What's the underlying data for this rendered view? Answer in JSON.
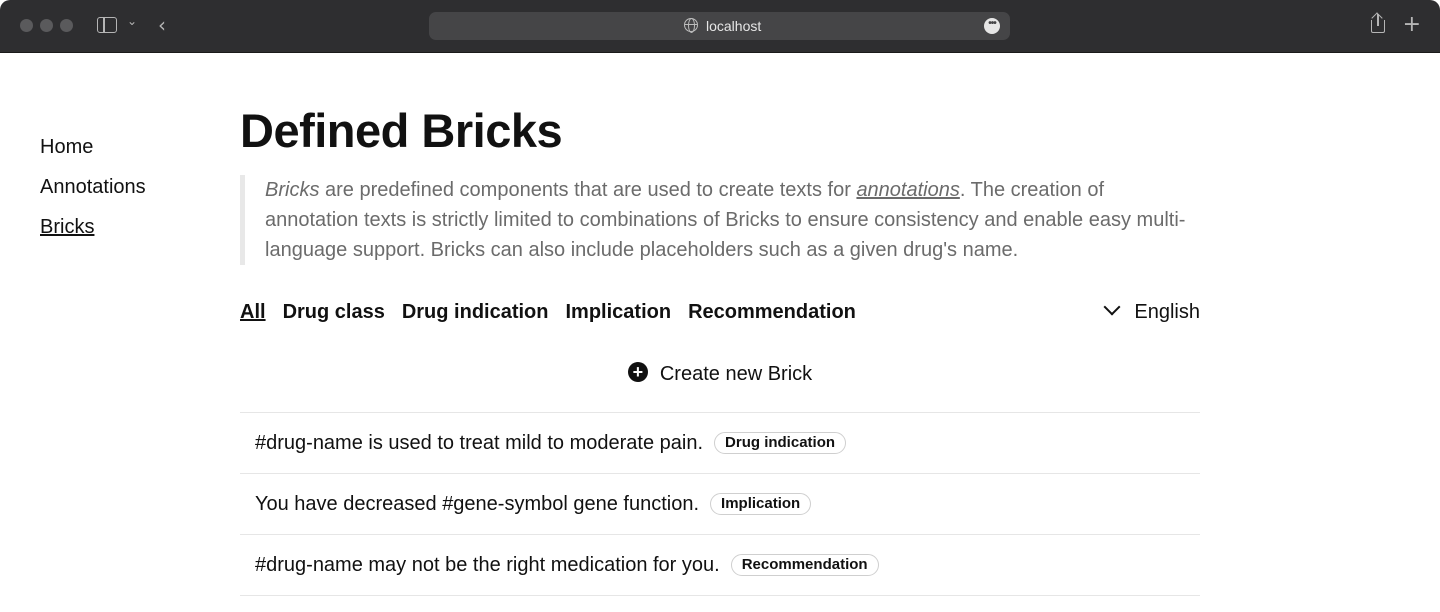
{
  "browser": {
    "url": "localhost"
  },
  "nav": {
    "items": [
      {
        "label": "Home",
        "active": false
      },
      {
        "label": "Annotations",
        "active": false
      },
      {
        "label": "Bricks",
        "active": true
      }
    ]
  },
  "main": {
    "title": "Defined Bricks",
    "description": {
      "term": "Bricks",
      "part1": " are predefined components that are used to create texts for ",
      "link": "annotations",
      "part2": ". The creation of annotation texts is strictly limited to combinations of Bricks to ensure consistency and enable easy multi-language support. Bricks can also include placeholders such as a given drug's name."
    },
    "filters": [
      {
        "label": "All",
        "active": true
      },
      {
        "label": "Drug class",
        "active": false
      },
      {
        "label": "Drug indication",
        "active": false
      },
      {
        "label": "Implication",
        "active": false
      },
      {
        "label": "Recommendation",
        "active": false
      }
    ],
    "language": "English",
    "create_label": "Create new Brick",
    "bricks": [
      {
        "text": "#drug-name is used to treat mild to moderate pain.",
        "category": "Drug indication"
      },
      {
        "text": "You have decreased #gene-symbol gene function.",
        "category": "Implication"
      },
      {
        "text": "#drug-name may not be the right medication for you.",
        "category": "Recommendation"
      }
    ]
  }
}
